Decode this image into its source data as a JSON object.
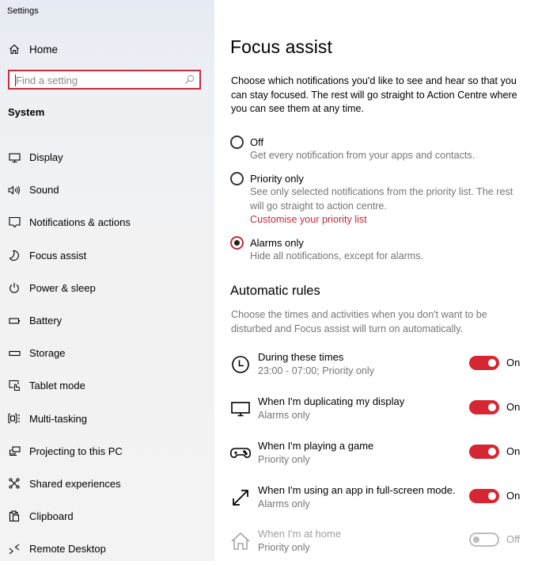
{
  "window": {
    "title": "Settings"
  },
  "sidebar": {
    "home_label": "Home",
    "search": {
      "placeholder": "Find a setting",
      "value": ""
    },
    "section_title": "System",
    "items": [
      {
        "label": "Display",
        "icon": "display-icon"
      },
      {
        "label": "Sound",
        "icon": "speaker-icon"
      },
      {
        "label": "Notifications & actions",
        "icon": "notification-icon"
      },
      {
        "label": "Focus assist",
        "icon": "moon-icon"
      },
      {
        "label": "Power & sleep",
        "icon": "power-icon"
      },
      {
        "label": "Battery",
        "icon": "battery-icon"
      },
      {
        "label": "Storage",
        "icon": "storage-icon"
      },
      {
        "label": "Tablet mode",
        "icon": "tablet-mode-icon"
      },
      {
        "label": "Multi-tasking",
        "icon": "multitasking-icon"
      },
      {
        "label": "Projecting to this PC",
        "icon": "projecting-icon"
      },
      {
        "label": "Shared experiences",
        "icon": "shared-experiences-icon"
      },
      {
        "label": "Clipboard",
        "icon": "clipboard-icon"
      },
      {
        "label": "Remote Desktop",
        "icon": "remote-desktop-icon"
      }
    ]
  },
  "main": {
    "title": "Focus assist",
    "intro": "Choose which notifications you'd like to see and hear so that you can stay focused. The rest will go straight to Action Centre where you can see them at any time.",
    "options": [
      {
        "label": "Off",
        "description": "Get every notification from your apps and contacts.",
        "selected": false
      },
      {
        "label": "Priority only",
        "description": "See only selected notifications from the priority list. The rest will go straight to action centre.",
        "link": "Customise your priority list",
        "selected": false
      },
      {
        "label": "Alarms only",
        "description": "Hide all notifications, except for alarms.",
        "selected": true
      }
    ],
    "automatic_rules": {
      "title": "Automatic rules",
      "description": "Choose the times and activities when you don't want to be disturbed and Focus assist will turn on automatically.",
      "rules": [
        {
          "name": "During these times",
          "detail": "23:00 - 07:00; Priority only",
          "state": "On",
          "enabled": true,
          "icon": "clock-icon"
        },
        {
          "name": "When I'm duplicating my display",
          "detail": "Alarms only",
          "state": "On",
          "enabled": true,
          "icon": "monitor-icon"
        },
        {
          "name": "When I'm playing a game",
          "detail": "Priority only",
          "state": "On",
          "enabled": true,
          "icon": "gamepad-icon"
        },
        {
          "name": "When I'm using an app in full-screen mode.",
          "detail": "Alarms only",
          "state": "On",
          "enabled": true,
          "icon": "fullscreen-arrows-icon"
        },
        {
          "name": "When I'm at home",
          "detail": "Priority only",
          "state": "Off",
          "enabled": false,
          "icon": "home-icon"
        }
      ]
    }
  },
  "colors": {
    "accent": "#d72633",
    "sidebar_bg": "#f2f2f2",
    "secondary_text": "#767676",
    "disabled_text": "#a0a0a0"
  }
}
